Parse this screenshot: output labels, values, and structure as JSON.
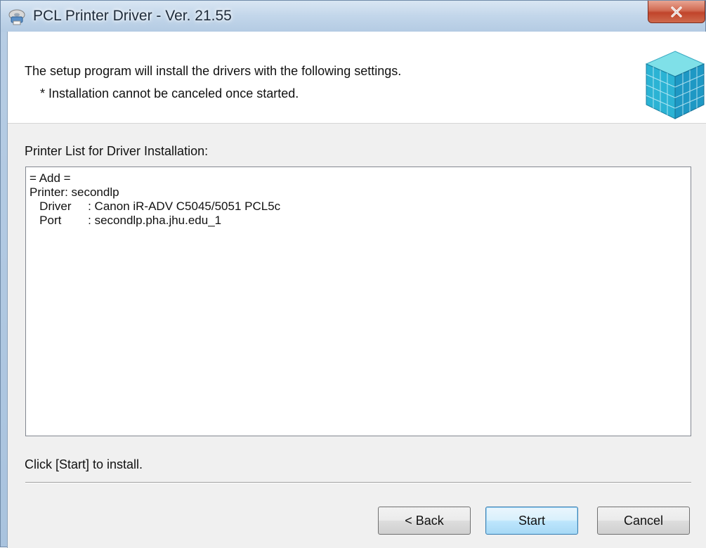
{
  "window": {
    "title": "PCL Printer Driver - Ver. 21.55",
    "app_icon": "printer-setup-icon",
    "close_icon": "close-icon"
  },
  "header": {
    "line1": "The setup program will install the drivers with the following settings.",
    "line2": "* Installation cannot be canceled once started.",
    "graphic": "cube-icon"
  },
  "printer_list": {
    "label": "Printer List for Driver Installation:",
    "lines": [
      "= Add =",
      "Printer: secondlp",
      "   Driver     : Canon iR-ADV C5045/5051 PCL5c",
      "   Port        : secondlp.pha.jhu.edu_1"
    ]
  },
  "instruction": "Click [Start] to install.",
  "buttons": {
    "back": "< Back",
    "start": "Start",
    "cancel": "Cancel"
  },
  "colors": {
    "close_button": "#c0442b",
    "default_button_border": "#3c7fb1",
    "dialog_background": "#f0f0f0"
  }
}
